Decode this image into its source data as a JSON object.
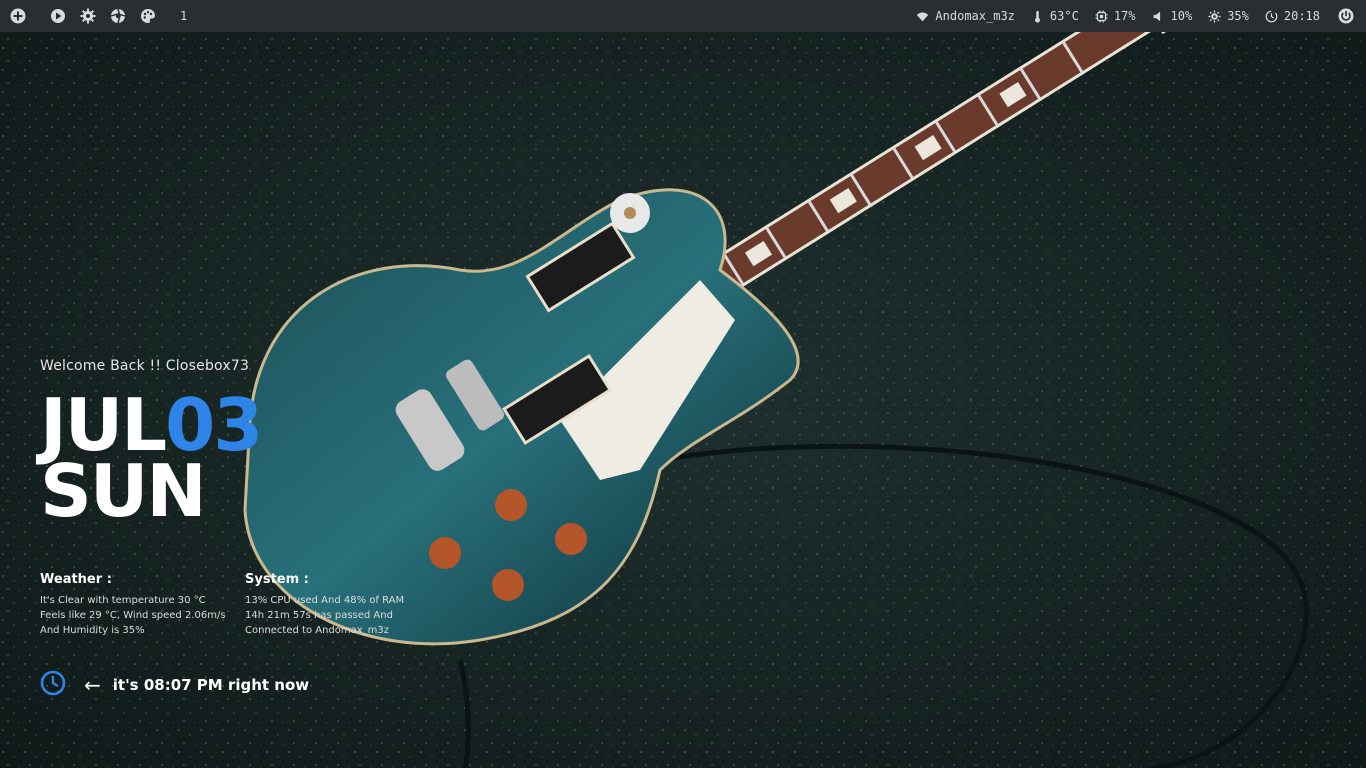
{
  "topbar": {
    "workspace_number": "1",
    "network": "Andomax_m3z",
    "temperature": "63°C",
    "cpu": "17%",
    "volume": "10%",
    "brightness": "35%",
    "clock": "20:18"
  },
  "overlay": {
    "welcome": "Welcome Back !! Closebox73",
    "month": "JUL",
    "day": "03",
    "weekday": "SUN",
    "weather_title": "Weather :",
    "weather_line1": "It's Clear with temperature 30 °C",
    "weather_line2": "Feels like 29 °C, Wind speed 2.06m/s",
    "weather_line3": "And Humidity is 35%",
    "system_title": "System :",
    "system_line1": "13% CPU used And 48% of RAM",
    "system_line2": "14h 21m 57s has passed And",
    "system_line3": "Connected to Andomax_m3z",
    "time_text": "it's 08:07 PM right now"
  },
  "colors": {
    "accent": "#2f84e8",
    "bar_bg": "#2a2d32"
  },
  "icons": {
    "add": "plus-circle-icon",
    "play": "play-circle-icon",
    "settings": "gear-icon",
    "shutter": "aperture-icon",
    "palette": "palette-icon",
    "wifi": "wifi-icon",
    "thermo": "thermometer-icon",
    "cpu": "cpu-icon",
    "volume": "speaker-icon",
    "brightness": "sun-icon",
    "timer": "clock-icon",
    "power": "power-icon"
  }
}
